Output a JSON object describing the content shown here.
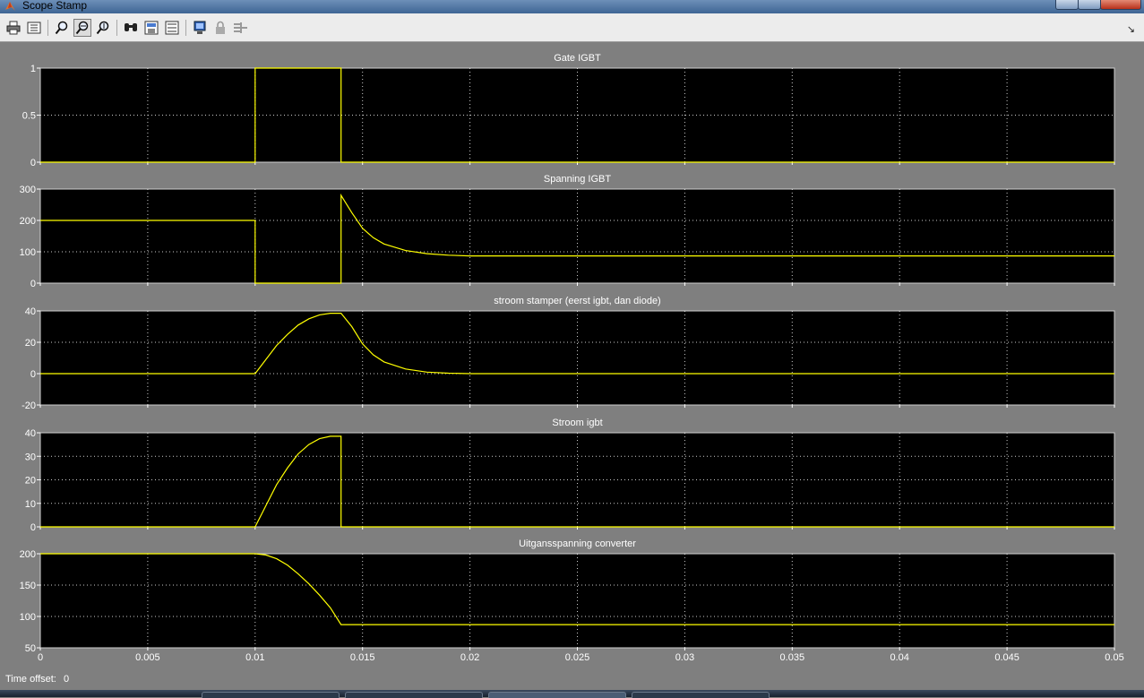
{
  "window": {
    "title": "Scope Stamp"
  },
  "toolbar": {
    "buttons": [
      {
        "icon": "print-icon"
      },
      {
        "icon": "parameters-icon"
      },
      {
        "icon": "zoom-icon"
      },
      {
        "icon": "zoom-x-icon"
      },
      {
        "icon": "zoom-y-icon"
      },
      {
        "icon": "autoscale-icon"
      },
      {
        "icon": "save-axes-icon"
      },
      {
        "icon": "restore-axes-icon"
      },
      {
        "icon": "floating-scope-icon"
      },
      {
        "icon": "lock-icon"
      },
      {
        "icon": "signal-selector-icon"
      }
    ],
    "dock_icon": "dock-icon"
  },
  "footer": {
    "time_offset_label": "Time offset:",
    "time_offset_value": "0"
  },
  "colors": {
    "background": "#7f7f7f",
    "axes": "#000000",
    "trace": "#ffff00",
    "grid": "#ffffff"
  },
  "chart_data": [
    {
      "type": "line",
      "title": "Gate IGBT",
      "xlim": [
        0,
        0.05
      ],
      "ylim": [
        0,
        1
      ],
      "yticks": [
        0,
        0.5,
        1
      ],
      "ytick_labels": [
        "0",
        "0.5",
        "1"
      ],
      "grid": true,
      "x": [
        0,
        0.01,
        0.01,
        0.014,
        0.014,
        0.05
      ],
      "y": [
        0,
        0,
        1,
        1,
        0,
        0
      ]
    },
    {
      "type": "line",
      "title": "Spanning IGBT",
      "xlim": [
        0,
        0.05
      ],
      "ylim": [
        0,
        300
      ],
      "yticks": [
        0,
        100,
        200,
        300
      ],
      "ytick_labels": [
        "0",
        "100",
        "200",
        "300"
      ],
      "grid": true,
      "x": [
        0,
        0.01,
        0.01,
        0.014,
        0.014,
        0.0145,
        0.015,
        0.0155,
        0.016,
        0.017,
        0.018,
        0.019,
        0.02,
        0.05
      ],
      "y": [
        200,
        200,
        0,
        0,
        280,
        225,
        175,
        145,
        125,
        104,
        94,
        89,
        87,
        87
      ]
    },
    {
      "type": "line",
      "title": "stroom stamper (eerst igbt, dan diode)",
      "xlim": [
        0,
        0.05
      ],
      "ylim": [
        -20,
        40
      ],
      "yticks": [
        -20,
        0,
        20,
        40
      ],
      "ytick_labels": [
        "-20",
        "0",
        "20",
        "40"
      ],
      "grid": true,
      "x": [
        0,
        0.01,
        0.0105,
        0.011,
        0.0115,
        0.012,
        0.0125,
        0.013,
        0.0135,
        0.014,
        0.0145,
        0.015,
        0.0155,
        0.016,
        0.017,
        0.018,
        0.019,
        0.02,
        0.05
      ],
      "y": [
        0,
        0,
        9,
        18,
        25,
        31,
        35,
        37.5,
        38.5,
        38.5,
        30,
        19,
        12,
        7.5,
        3,
        1,
        0.3,
        0,
        0
      ]
    },
    {
      "type": "line",
      "title": "Stroom igbt",
      "xlim": [
        0,
        0.05
      ],
      "ylim": [
        0,
        40
      ],
      "yticks": [
        0,
        10,
        20,
        30,
        40
      ],
      "ytick_labels": [
        "0",
        "10",
        "20",
        "30",
        "40"
      ],
      "grid": true,
      "x": [
        0,
        0.01,
        0.0105,
        0.011,
        0.0115,
        0.012,
        0.0125,
        0.013,
        0.0135,
        0.014,
        0.014,
        0.05
      ],
      "y": [
        0,
        0,
        9,
        18,
        25,
        31,
        35,
        37.5,
        38.5,
        38.5,
        0,
        0
      ]
    },
    {
      "type": "line",
      "title": "Uitgansspanning converter",
      "xlim": [
        0,
        0.05
      ],
      "ylim": [
        50,
        200
      ],
      "yticks": [
        50,
        100,
        150,
        200
      ],
      "ytick_labels": [
        "50",
        "100",
        "150",
        "200"
      ],
      "xticks": [
        0,
        0.005,
        0.01,
        0.015,
        0.02,
        0.025,
        0.03,
        0.035,
        0.04,
        0.045,
        0.05
      ],
      "xtick_labels": [
        "0",
        "0.005",
        "0.01",
        "0.015",
        "0.02",
        "0.025",
        "0.03",
        "0.035",
        "0.04",
        "0.045",
        "0.05"
      ],
      "grid": true,
      "x": [
        0,
        0.01,
        0.0105,
        0.011,
        0.0115,
        0.012,
        0.0125,
        0.013,
        0.0135,
        0.014,
        0.05
      ],
      "y": [
        200,
        200,
        198,
        192,
        182,
        168,
        152,
        134,
        114,
        87,
        87
      ]
    }
  ]
}
